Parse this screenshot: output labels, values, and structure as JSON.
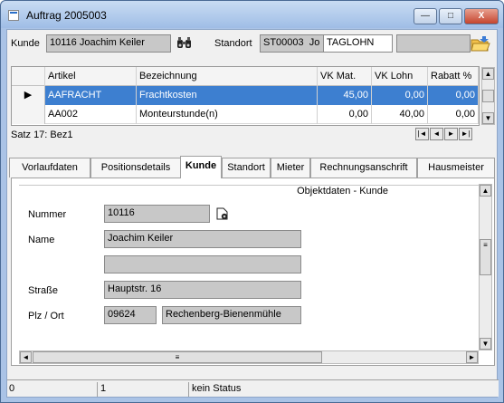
{
  "window": {
    "title": "Auftrag 2005003",
    "min": "—",
    "max": "□",
    "close": "X"
  },
  "header": {
    "kunde_label": "Kunde",
    "kunde_value": "10116 Joachim Keiler",
    "standort_label": "Standort",
    "standort_code": "ST00003",
    "standort_code_suffix": "Jo",
    "standort_combo": "TAGLOHN",
    "standort_extra": ""
  },
  "grid": {
    "columns": [
      "Artikel",
      "Bezeichnung",
      "VK Mat.",
      "VK Lohn",
      "Rabatt %"
    ],
    "rows": [
      {
        "artikel": "AAFRACHT",
        "bezeichnung": "Frachtkosten",
        "vk_mat": "45,00",
        "vk_lohn": "0,00",
        "rabatt": "0,00"
      },
      {
        "artikel": "AA002",
        "bezeichnung": "Monteurstunde(n)",
        "vk_mat": "0,00",
        "vk_lohn": "40,00",
        "rabatt": "0,00"
      }
    ],
    "record_label": "Satz 17: Bez1",
    "nav": {
      "first": "|◄",
      "prev": "◄",
      "next": "►",
      "last": "►|"
    }
  },
  "tabs": [
    "Vorlaufdaten",
    "Positionsdetails",
    "Kunde",
    "Standort",
    "Mieter",
    "Rechnungsanschrift",
    "Hausmeister"
  ],
  "active_tab": "Kunde",
  "panel": {
    "section_title": "Objektdaten - Kunde",
    "nummer_label": "Nummer",
    "nummer_value": "10116",
    "name_label": "Name",
    "name_value": "Joachim Keiler",
    "name2_value": "",
    "strasse_label": "Straße",
    "strasse_value": "Hauptstr. 16",
    "plzort_label": "Plz / Ort",
    "plz_value": "09624",
    "ort_value": "Rechenberg-Bienenmühle"
  },
  "status": {
    "field1": "0",
    "field2": "1",
    "field3": "kein Status"
  },
  "icons": {
    "lookup": "binoculars-icon",
    "open": "folder-open-icon",
    "arrow": "row-indicator-icon"
  }
}
